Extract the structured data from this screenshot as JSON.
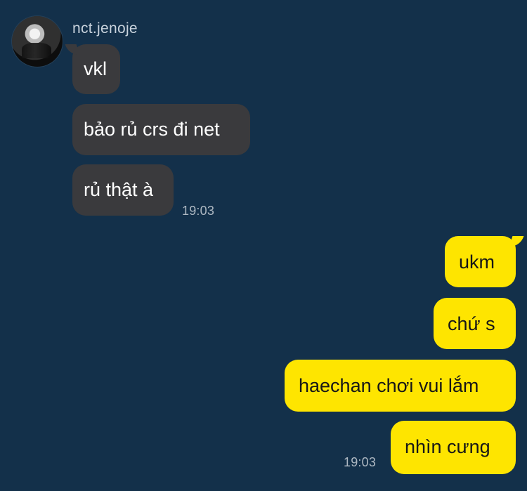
{
  "chat": {
    "sender": {
      "name": "nct.jenoje"
    },
    "incoming_messages": [
      {
        "text": "vkl"
      },
      {
        "text": "bảo rủ crs đi net"
      },
      {
        "text": "rủ thật à"
      }
    ],
    "incoming_time": "19:03",
    "outgoing_messages": [
      {
        "text": "ukm"
      },
      {
        "text": "chứ s"
      },
      {
        "text": "haechan chơi vui lắm"
      },
      {
        "text": "nhìn cưng"
      }
    ],
    "outgoing_time": "19:03"
  },
  "colors": {
    "background": "#13304a",
    "incoming_bubble": "#3a3a3d",
    "outgoing_bubble": "#fee500",
    "incoming_text": "#ffffff",
    "outgoing_text": "#171717",
    "timestamp": "#aeb8c2",
    "sender_name": "#c8d2dc"
  }
}
